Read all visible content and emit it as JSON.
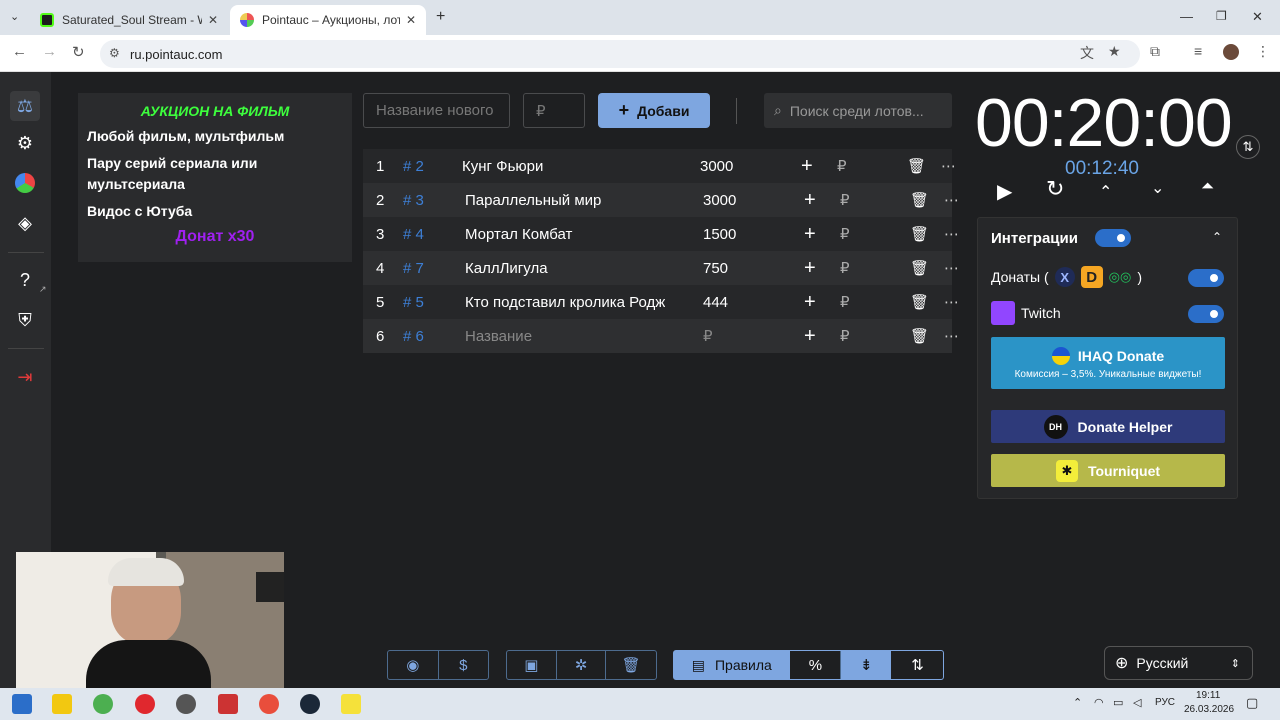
{
  "browser": {
    "tabs": [
      {
        "title": "Saturated_Soul Stream - Watch",
        "active": false
      },
      {
        "title": "Pointauc – Аукционы, лотереи",
        "active": true
      }
    ],
    "url": "ru.pointauc.com"
  },
  "rules": {
    "title": "АУКЦИОН НА ФИЛЬМ",
    "lines": [
      "Любой фильм, мультфильм",
      "Пару серий сериала или мультсериала",
      "Видос с Ютуба"
    ],
    "donate": "Донат х30"
  },
  "toolbar": {
    "name_placeholder": "Название нового",
    "amount_placeholder": "₽",
    "add_label": "Добави",
    "search_placeholder": "Поиск среди лотов..."
  },
  "lots": [
    {
      "num": "1",
      "id": "# 2",
      "name": "Кунг Фьюри",
      "amount": "3000"
    },
    {
      "num": "2",
      "id": "# 3",
      "name": "Параллельный мир",
      "amount": "3000"
    },
    {
      "num": "3",
      "id": "# 4",
      "name": "Мортал Комбат",
      "amount": "1500"
    },
    {
      "num": "4",
      "id": "# 7",
      "name": "КаллЛигула",
      "amount": "750"
    },
    {
      "num": "5",
      "id": "# 5",
      "name": "Кто подставил кролика Роджера",
      "amount": "444"
    },
    {
      "num": "6",
      "id": "# 6",
      "name": "Название",
      "amount": "₽"
    }
  ],
  "currency_sign": "₽",
  "timer": {
    "main": "00:20:00",
    "elapsed": "00:12:40"
  },
  "integrations": {
    "title": "Интеграции",
    "donations_label": "Донаты (",
    "donations_close": ")",
    "twitch_label": "Twitch",
    "ihaq_title": "IHAQ Donate",
    "ihaq_sub": "Комиссия – 3,5%. Уникальные виджеты!",
    "donate_helper": "Donate Helper",
    "tourniquet": "Tourniquet"
  },
  "bottom_bar": {
    "rules_label": "Правила"
  },
  "language": "Русский",
  "taskbar": {
    "lang": "РУС",
    "time": "19:11",
    "date": "26.03.2026"
  },
  "colors": {
    "accent": "#7ea6e0",
    "rules_title": "#3dff3d",
    "donate": "#a020f0",
    "id": "#3d7fd6",
    "toggle": "#2b6ec9"
  }
}
